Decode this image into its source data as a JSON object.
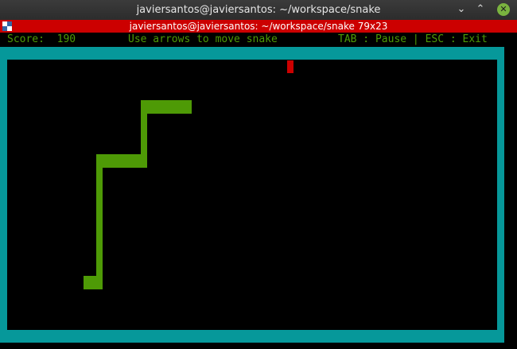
{
  "window": {
    "title": "javiersantos@javiersantos: ~/workspace/snake",
    "minimize_glyph": "⌄",
    "maximize_glyph": "⌃",
    "close_glyph": "✕"
  },
  "tab": {
    "title": "javiersantos@javiersantos: ~/workspace/snake 79x23"
  },
  "status": {
    "score_label": "Score:",
    "score_value": "190",
    "hint": "Use arrows to move snake",
    "keys": "TAB : Pause | ESC : Exit"
  },
  "game": {
    "snake_color": "#4e9a06",
    "food_color": "#cc0000",
    "border_color": "#06989a",
    "snake_length_segments": 5
  },
  "colors": {
    "titlebar": "#2f2f2f",
    "tabbar": "#cc0000",
    "text_green": "#4e9a06"
  }
}
